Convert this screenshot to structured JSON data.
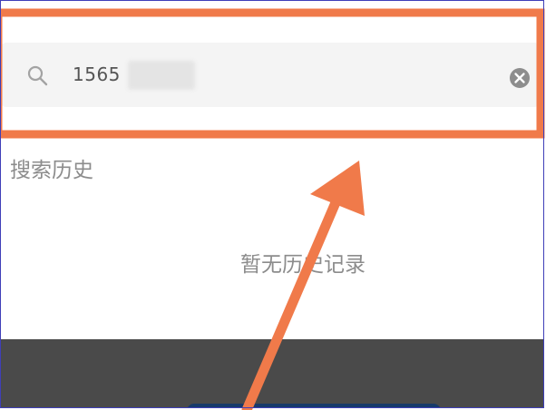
{
  "search": {
    "value": "1565",
    "icon": "search-icon",
    "clear_icon": "clear-icon"
  },
  "history": {
    "title": "搜索历史",
    "empty_text": "暂无历史记录"
  },
  "colors": {
    "annotation": "#f07a4a",
    "search_bg": "#f4f4f4",
    "bottom_panel": "#4a4a4a",
    "bottom_button": "#173a6a"
  }
}
